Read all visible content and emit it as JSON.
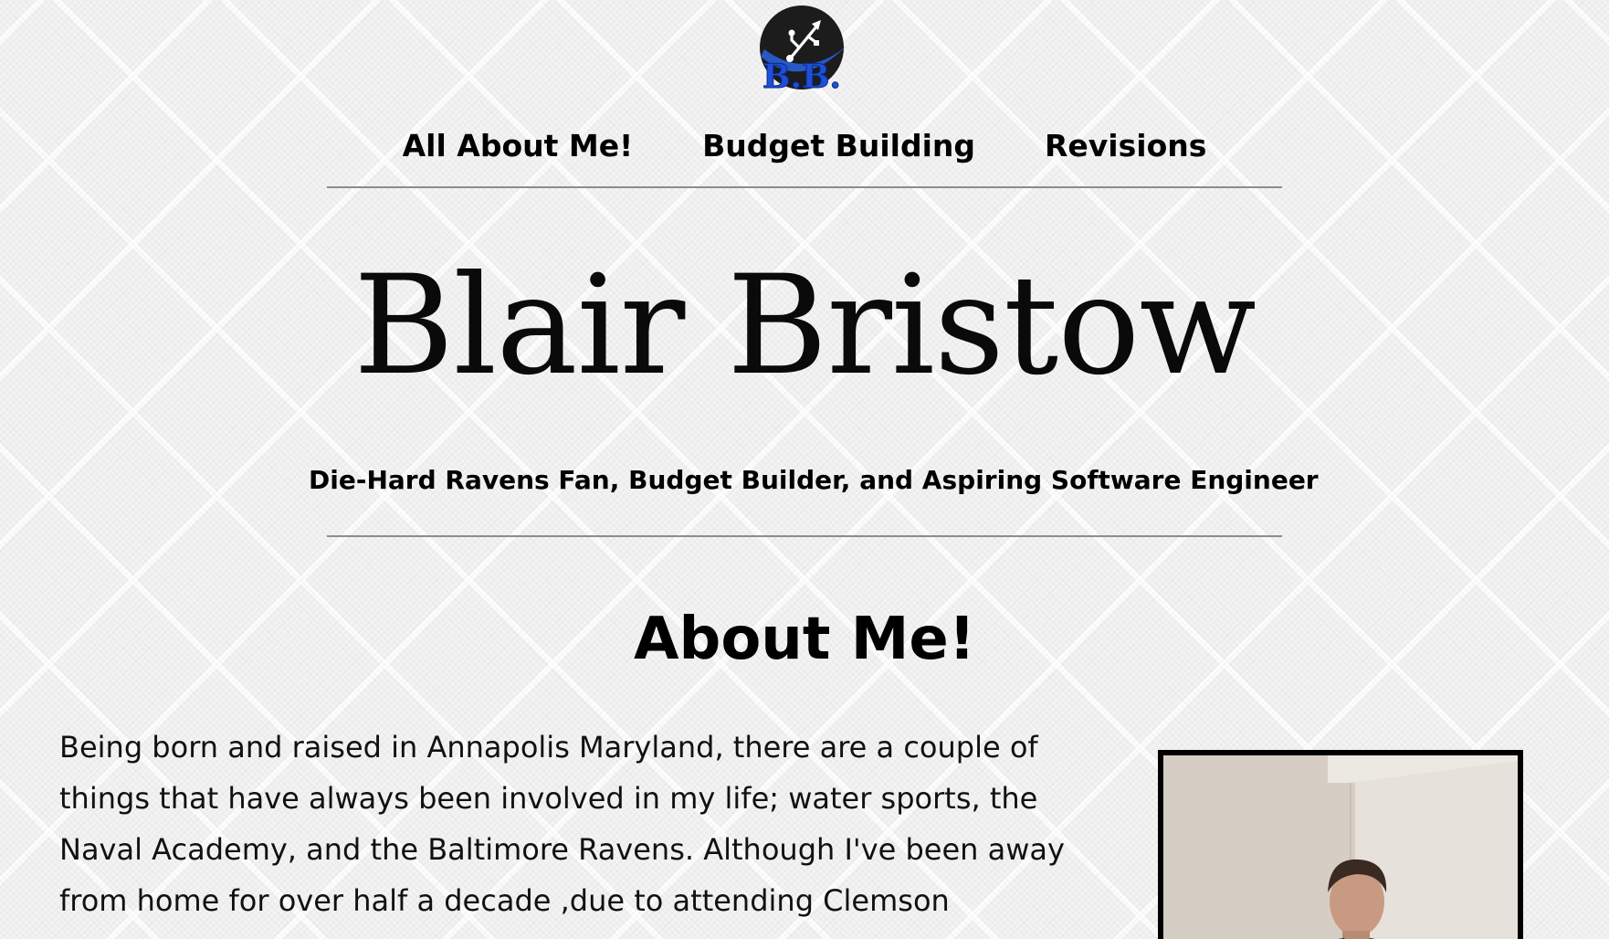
{
  "logo": {
    "text": "B.B.",
    "icon": "usb-icon"
  },
  "nav": {
    "items": [
      {
        "label": "All About Me!"
      },
      {
        "label": "Budget Building"
      },
      {
        "label": "Revisions"
      }
    ]
  },
  "hero": {
    "name": "Blair Bristow",
    "tagline": "Die-Hard Ravens Fan, Budget Builder, and Aspiring Software Engineer"
  },
  "about": {
    "heading": "About Me!",
    "paragraph": "Being born and raised in Annapolis Maryland, there are a couple of things that have always been involved in my life; water sports, the Naval Academy, and the Baltimore Ravens. Although I've been away from home for over half a decade ,due to attending Clemson",
    "photo_icon": "portrait-photo"
  },
  "colors": {
    "logo_blue": "#1f4fd8",
    "logo_dark": "#1c1c1c",
    "rule": "#8c8c8c",
    "text": "#000000"
  }
}
